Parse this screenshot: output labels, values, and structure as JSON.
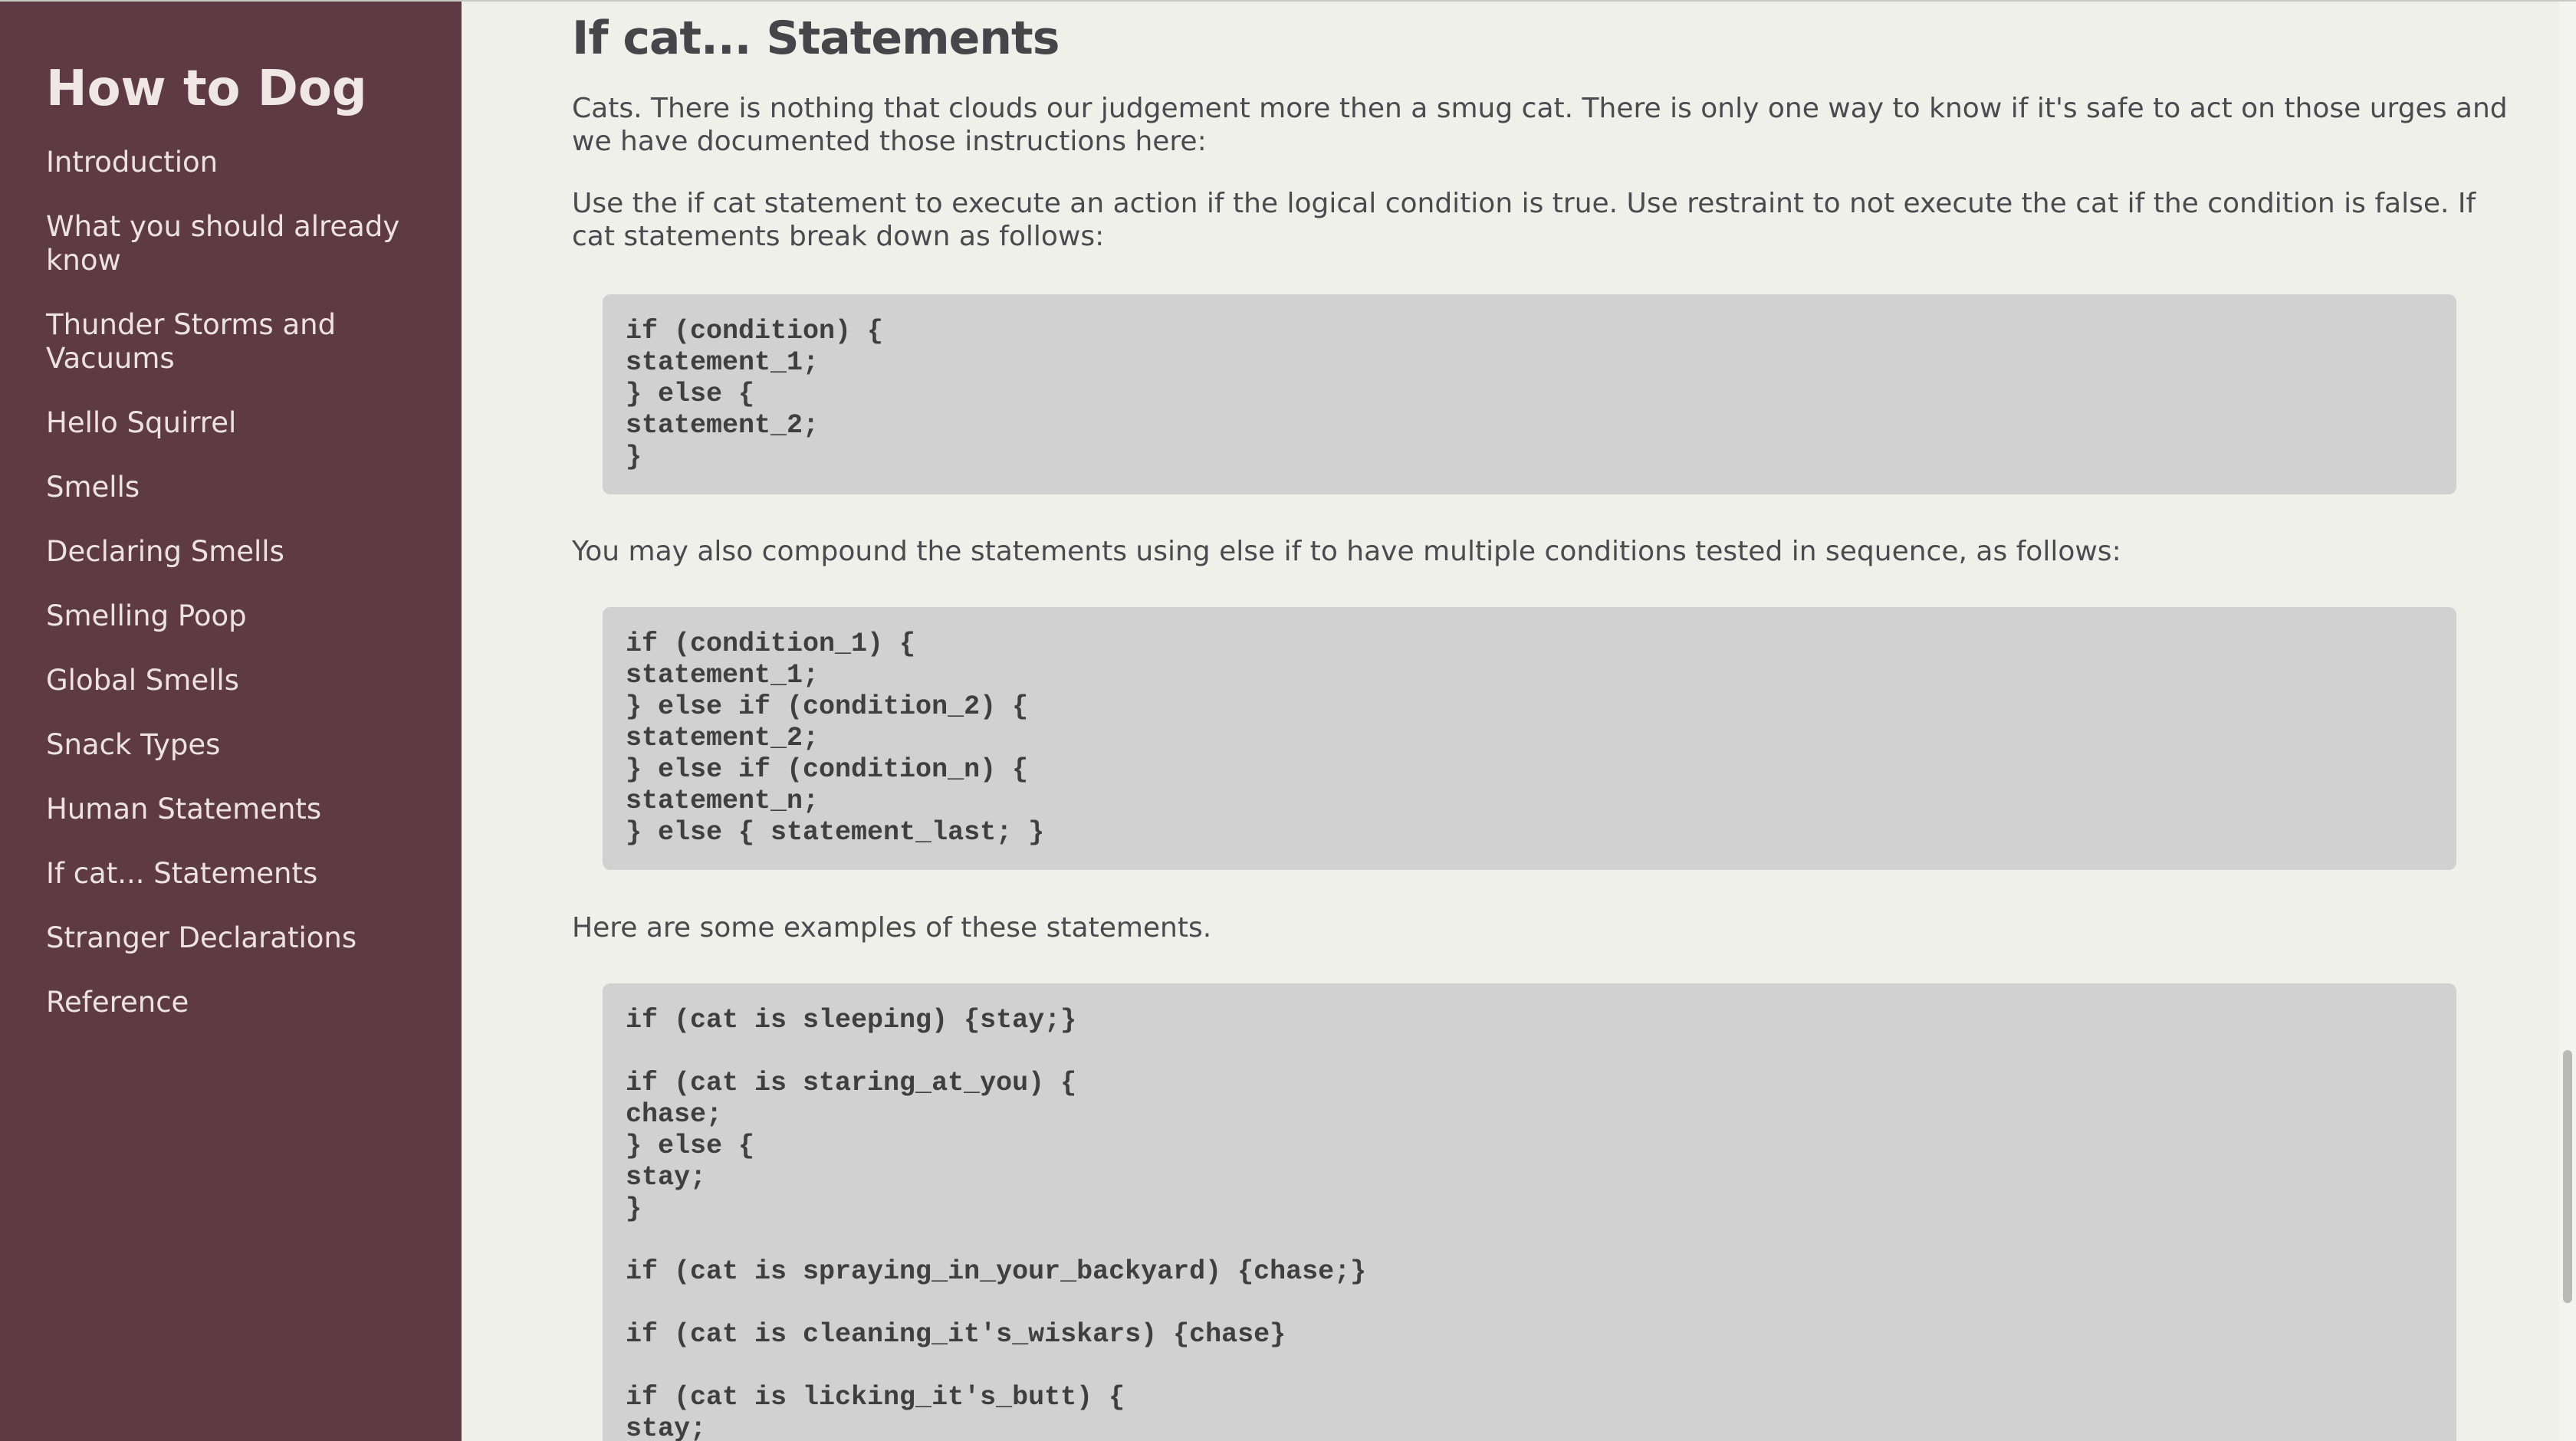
{
  "navbar": {
    "title": "How to Dog",
    "items": [
      {
        "label": "Introduction"
      },
      {
        "label": "What you should already know"
      },
      {
        "label": "Thunder Storms and Vacuums"
      },
      {
        "label": "Hello Squirrel"
      },
      {
        "label": "Smells"
      },
      {
        "label": "Declaring Smells"
      },
      {
        "label": "Smelling Poop"
      },
      {
        "label": "Global Smells"
      },
      {
        "label": "Snack Types"
      },
      {
        "label": "Human Statements"
      },
      {
        "label": "If cat... Statements"
      },
      {
        "label": "Stranger Declarations"
      },
      {
        "label": "Reference"
      }
    ]
  },
  "section": {
    "title": "If cat... Statements",
    "para1": "Cats. There is nothing that clouds our judgement more then a smug cat. There is only one way to know if it's safe to act on those urges and we have documented those instructions here:",
    "para2": "Use the if cat statement to execute an action if the logical condition is true. Use restraint to not execute the cat if the condition is false. If cat statements break down as follows:",
    "code1": "if (condition) {\nstatement_1;\n} else {\nstatement_2;\n}",
    "para3": "You may also compound the statements using else if to have multiple conditions tested in sequence, as follows:",
    "code2": "if (condition_1) {\nstatement_1;\n} else if (condition_2) {\nstatement_2;\n} else if (condition_n) {\nstatement_n;\n} else { statement_last; }",
    "para4": "Here are some examples of these statements.",
    "code3": "if (cat is sleeping) {stay;}\n\nif (cat is staring_at_you) {\nchase;\n} else {\nstay;\n}\n\nif (cat is spraying_in_your_backyard) {chase;}\n\nif (cat is cleaning_it's_wiskars) {chase}\n\nif (cat is licking_it's_butt) {\nstay;"
  },
  "colors": {
    "sidebar_bg": "#5e3a44",
    "content_bg": "#f0f0eb",
    "code_bg": "#d1d1d1"
  }
}
